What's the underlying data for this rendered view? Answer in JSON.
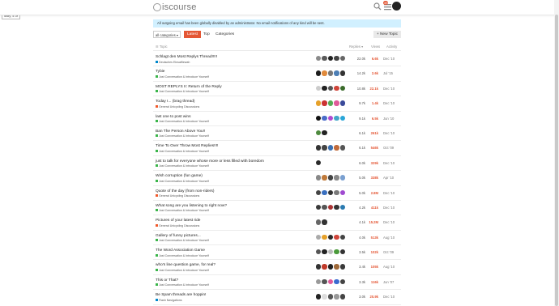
{
  "badge": "daily, 4 ur",
  "header": {
    "logo_text": "iscourse",
    "notification_count": "49"
  },
  "alert": "All outgoing email has been globally disabled by an administrator. No email notifications of any kind will be sent.",
  "nav": {
    "category_select": "all categories ▾",
    "tabs": [
      "Latest",
      "Top",
      "Categories"
    ],
    "new_topic": "+ New Topic"
  },
  "table": {
    "headers": {
      "topic": "☰ Topic",
      "replies": "Replies ▾",
      "views": "Views",
      "activity": "Activity"
    }
  },
  "colors": {
    "accent": "#e45735",
    "alert_bg": "#d1f0ff",
    "cat_general": "#f1592a",
    "cat_lounge": "#3ab54a",
    "cat_intro": "#0088cc"
  },
  "topics": [
    {
      "title": "Schlagt den Most Replys Thread!!!!!",
      "category": "Deutsches Einsatfiewah",
      "replies": "22.0k",
      "views": "6.6k",
      "activity": "Dec '10",
      "avatars": [
        "#8a8a8a",
        "#5a5a5a",
        "#222222",
        "#444444",
        "#666666"
      ]
    },
    {
      "title": "Tybie",
      "category": "Just Conversation & Introduce Yourself",
      "replies": "14.2k",
      "views": "2.6k",
      "activity": "Jul '15",
      "avatars": [
        "#1d1d1d",
        "#e08a3c",
        "#777777",
        "#4d7fb5",
        "#333333"
      ]
    },
    {
      "title": "MOST REPLYS II: Return of the Reply",
      "category": "Just Conversation & Introduce Yourself",
      "replies": "10.8k",
      "views": "22.1k",
      "activity": "Dec '10",
      "avatars": [
        "#cccccc",
        "#222222",
        "#555555",
        "#d0453a",
        "#3a6b2b"
      ]
    },
    {
      "title": "Today I... (brag thread)",
      "category": "General Unicycling Discussions",
      "replies": "9.7k",
      "views": "1.4k",
      "activity": "Dec '10",
      "avatars": [
        "#e6a12a",
        "#cc3333",
        "#55aa55",
        "#e05a9a",
        "#3a4a9a"
      ]
    },
    {
      "title": "last one to post wins",
      "category": "Just Conversation & Introduce Yourself",
      "replies": "9.1k",
      "views": "6.5k",
      "activity": "Jun '10",
      "avatars": [
        "#111111",
        "#4a6cc9",
        "#b04ad0",
        "#44a6c8",
        "#2aa6d8"
      ]
    },
    {
      "title": "Ban The Person Above You!!",
      "category": "Just Conversation & Introduce Yourself",
      "replies": "6.1k",
      "views": "261k",
      "activity": "Dec '10",
      "avatars": [
        "#4e8a3e",
        "#222222"
      ]
    },
    {
      "title": "Time To Over Throw Most Replies!!!!",
      "category": "Just Conversation & Introduce Yourself",
      "replies": "6.1k",
      "views": "546k",
      "activity": "Oct '09",
      "avatars": [
        "#333333",
        "#444444",
        "#3a6fb0",
        "#c06a3a",
        "#555555"
      ]
    },
    {
      "title": "just to talk for everyone whose more or less filled with boredom",
      "category": "Just Conversation & Introduce Yourself",
      "replies": "6.0k",
      "views": "329k",
      "activity": "Dec '10",
      "avatars": [
        "#2a2a2a"
      ]
    },
    {
      "title": "Wish corruption (fun game)",
      "category": "Just Conversation & Introduce Yourself",
      "replies": "5.0k",
      "views": "338k",
      "activity": "Apr '10",
      "avatars": [
        "#888888",
        "#c07a3a",
        "#444444",
        "#888888",
        "#7aa0d0"
      ]
    },
    {
      "title": "Quote of the day (from non-riders)",
      "category": "General Unicycling Discussions",
      "replies": "5.0k",
      "views": "2.8M",
      "activity": "Dec '10",
      "avatars": [
        "#444444",
        "#3a70c0",
        "#333333",
        "#7a7a7a",
        "#a04ad0"
      ]
    },
    {
      "title": "What song are you listening to right now?",
      "category": "Just Conversation & Introduce Yourself",
      "replies": "4.2k",
      "views": "411k",
      "activity": "Dec '10",
      "avatars": [
        "#3a3a3a",
        "#555555",
        "#aa3333",
        "#333333",
        "#2a7ab0"
      ]
    },
    {
      "title": "Pictures of your latest ride",
      "category": "General Unicycling Discussions",
      "replies": "4.1k",
      "views": "15.2M",
      "activity": "Dec '10",
      "avatars": [
        "#666666",
        "#333333"
      ]
    },
    {
      "title": "Gallery of funny pictures...",
      "category": "Just Conversation & Introduce Yourself",
      "replies": "4.0k",
      "views": "513k",
      "activity": "Aug '10",
      "avatars": [
        "#aaaaaa",
        "#e6a12a",
        "#2a2a2a",
        "#d0453a",
        "#444444"
      ]
    },
    {
      "title": "The Word Association Game",
      "category": "Just Conversation & Introduce Yourself",
      "replies": "3.5k",
      "views": "102k",
      "activity": "Oct '09",
      "avatars": [
        "#555555",
        "#222222",
        "#bbbbbb",
        "#4a9a3a",
        "#333333"
      ]
    },
    {
      "title": "who's line question game, for real?",
      "category": "Just Conversation & Introduce Yourself",
      "replies": "3.4k",
      "views": "105k",
      "activity": "Aug '10",
      "avatars": [
        "#333333",
        "#c03a2a",
        "#222222",
        "#a06a3a",
        "#3a3a3a"
      ]
    },
    {
      "title": "This or That?",
      "category": "Just Conversation & Introduce Yourself",
      "replies": "3.3k",
      "views": "116k",
      "activity": "Jun '07",
      "avatars": [
        "#999999",
        "#555555",
        "#e05a9a",
        "#3a6ad0",
        "#444444"
      ]
    },
    {
      "title": "Be Spam threads are hoppin!",
      "category": "Flash Navigations",
      "replies": "3.0k",
      "views": "20.9k",
      "activity": "Dec '10",
      "avatars": [
        "#222222",
        "#dddddd",
        "#555555",
        "#999999",
        "#444444"
      ]
    }
  ]
}
